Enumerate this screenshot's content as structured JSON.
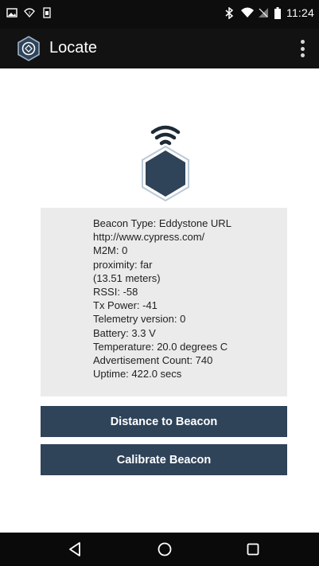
{
  "status_bar": {
    "time": "11:24",
    "icons_left": [
      "gallery-icon",
      "wifi-question-icon",
      "sim-icon"
    ],
    "icons_right": [
      "bluetooth-icon",
      "wifi-icon",
      "no-sim-icon",
      "battery-icon"
    ]
  },
  "app_bar": {
    "title": "Locate",
    "logo_icon": "hexagon-logo-icon",
    "menu_icon": "overflow-menu-icon"
  },
  "beacon": {
    "icon": "beacon-signal-icon",
    "info_lines": [
      "Beacon Type: Eddystone URL",
      "http://www.cypress.com/",
      "M2M: 0",
      "proximity: far",
      "(13.51 meters)",
      "RSSI: -58",
      "Tx Power: -41",
      "Telemetry version: 0",
      "Battery: 3.3 V",
      "Temperature: 20.0 degrees C",
      "Advertisement Count: 740",
      "Uptime: 422.0 secs"
    ]
  },
  "actions": {
    "distance_label": "Distance to Beacon",
    "calibrate_label": "Calibrate Beacon"
  },
  "nav_bar": {
    "back_icon": "back-triangle-icon",
    "home_icon": "home-circle-icon",
    "recents_icon": "recents-square-icon"
  },
  "colors": {
    "app_bar": "#121212",
    "button": "#2f4359",
    "panel": "#ebebeb",
    "hexagon": "#2f4359"
  }
}
